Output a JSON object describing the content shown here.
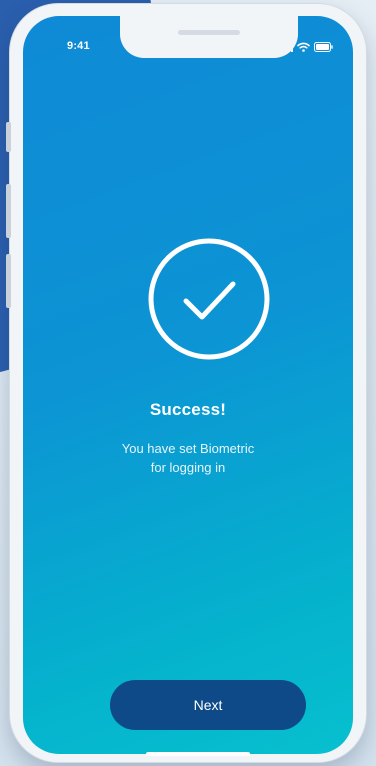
{
  "status_bar": {
    "time": "9:41",
    "icons": [
      "signal-icon",
      "wifi-icon",
      "battery-icon"
    ]
  },
  "success": {
    "icon": "checkmark-circle-icon",
    "title": "Success!",
    "message_line1": "You have set Biometric",
    "message_line2": "for logging in"
  },
  "actions": {
    "next_label": "Next"
  },
  "colors": {
    "gradient_start": "#0f8ad6",
    "gradient_end": "#07c0cf",
    "button_bg": "#0e4a87",
    "text": "#ffffff"
  }
}
